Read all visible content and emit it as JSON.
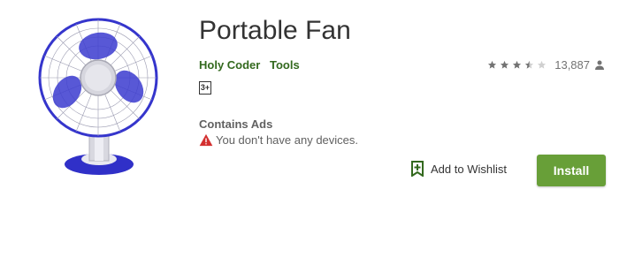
{
  "app": {
    "title": "Portable Fan",
    "developer": "Holy Coder",
    "category": "Tools",
    "content_rating": "3+",
    "rating_stars": 3.5,
    "rating_count": "13,887",
    "contains_ads": "Contains Ads",
    "device_warning": "You don't have any devices.",
    "wishlist_label": "Add to Wishlist",
    "install_label": "Install"
  },
  "icons": {
    "app_icon": "table-fan-icon",
    "star": "star-icon",
    "person": "person-icon",
    "warning": "warning-icon",
    "bookmark": "bookmark-add-icon"
  },
  "colors": {
    "accent_green": "#689f38",
    "link_green": "#33691e",
    "warning_red": "#d32f2f",
    "star_gray": "#737373",
    "fan_blue": "#3a3acc"
  }
}
